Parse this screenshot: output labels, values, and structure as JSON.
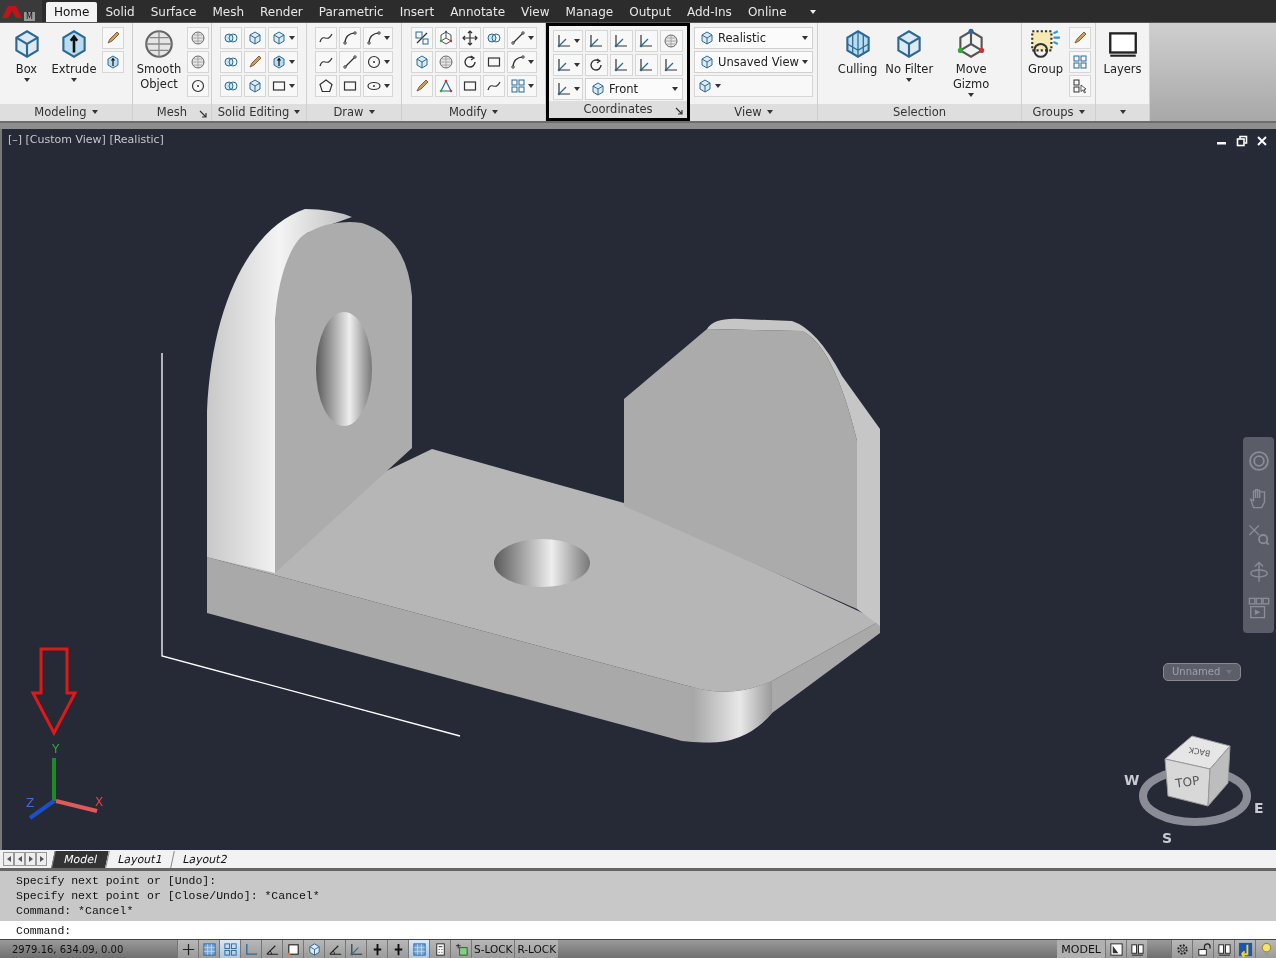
{
  "tab_bar": {
    "app_letter": "M",
    "tabs": [
      {
        "label": "Home",
        "selected": true
      },
      {
        "label": "Solid",
        "selected": false
      },
      {
        "label": "Surface",
        "selected": false
      },
      {
        "label": "Mesh",
        "selected": false
      },
      {
        "label": "Render",
        "selected": false
      },
      {
        "label": "Parametric",
        "selected": false
      },
      {
        "label": "Insert",
        "selected": false
      },
      {
        "label": "Annotate",
        "selected": false
      },
      {
        "label": "View",
        "selected": false
      },
      {
        "label": "Manage",
        "selected": false
      },
      {
        "label": "Output",
        "selected": false
      },
      {
        "label": "Add-Ins",
        "selected": false
      },
      {
        "label": "Online",
        "selected": false
      }
    ]
  },
  "ribbon": {
    "panels": [
      {
        "kind": "modeling",
        "title": "Modeling",
        "menu": true,
        "highlighted": false,
        "large_buttons": [
          {
            "label": "Box",
            "dropdown": true
          },
          {
            "label": "Extrude",
            "dropdown": true
          }
        ]
      },
      {
        "kind": "mesh",
        "title": "Mesh",
        "launcher": true,
        "highlighted": false,
        "large_buttons": [
          {
            "label": "Smooth Object",
            "dropdown": false
          }
        ]
      },
      {
        "kind": "solid_editing",
        "title": "Solid Editing",
        "menu": true,
        "highlighted": false
      },
      {
        "kind": "draw",
        "title": "Draw",
        "menu": true,
        "highlighted": false
      },
      {
        "kind": "modify",
        "title": "Modify",
        "menu": true,
        "highlighted": false
      },
      {
        "kind": "coordinates",
        "title": "Coordinates",
        "launcher": true,
        "highlighted": true,
        "selects": [
          {
            "value": "Front"
          }
        ]
      },
      {
        "kind": "view",
        "title": "View",
        "menu": true,
        "highlighted": false,
        "selects": [
          {
            "value": "Realistic"
          },
          {
            "value": "Unsaved View"
          }
        ]
      },
      {
        "kind": "selection",
        "title": "Selection",
        "highlighted": false,
        "large_buttons": [
          {
            "label": "Culling",
            "dropdown": false
          },
          {
            "label": "No Filter",
            "dropdown": true
          },
          {
            "label": "Move Gizmo",
            "dropdown": true
          }
        ]
      },
      {
        "kind": "groups",
        "title": "Groups",
        "menu": true,
        "highlighted": false,
        "large_buttons": [
          {
            "label": "Group",
            "dropdown": false
          }
        ]
      },
      {
        "kind": "layers",
        "menu": true,
        "highlighted": false,
        "large_buttons": [
          {
            "label": "Layers",
            "dropdown": false
          }
        ]
      }
    ]
  },
  "viewport": {
    "label": "[–] [Custom View] [Realistic]",
    "view_name": "Unnamed",
    "ucs": {
      "x": "X",
      "y": "Y",
      "z": "Z"
    },
    "viewcube": {
      "top": "TOP",
      "back": "BACK",
      "west": "W",
      "south": "S",
      "east": "E"
    }
  },
  "layout_tabs": [
    {
      "label": "Model",
      "selected": true
    },
    {
      "label": "Layout1",
      "selected": false
    },
    {
      "label": "Layout2",
      "selected": false
    }
  ],
  "command_line": {
    "history": [
      "Specify next point or [Undo]:",
      "Specify next point or [Close/Undo]: *Cancel*",
      "Command: *Cancel*"
    ],
    "prompt": "Command:"
  },
  "status_bar": {
    "coordinates": "2979.16, 634.09, 0.00",
    "toggles": [
      {
        "kind": "infer",
        "on": false
      },
      {
        "kind": "snap",
        "on": false
      },
      {
        "kind": "grid",
        "on": true
      },
      {
        "kind": "ortho",
        "on": false
      },
      {
        "kind": "polar",
        "on": false
      },
      {
        "kind": "osnap",
        "on": false
      },
      {
        "kind": "osnap3d",
        "on": false
      },
      {
        "kind": "otrack",
        "on": false
      },
      {
        "kind": "ducs",
        "on": false
      },
      {
        "kind": "dyn",
        "on": false
      },
      {
        "kind": "lineweight",
        "on": false
      },
      {
        "kind": "transparency",
        "on": true
      },
      {
        "kind": "quickprops",
        "on": false
      },
      {
        "kind": "selcycle",
        "on": false
      }
    ],
    "locks": [
      {
        "label": "S-LOCK",
        "on": false
      },
      {
        "label": "R-LOCK",
        "on": false
      }
    ],
    "space": "MODEL"
  }
}
